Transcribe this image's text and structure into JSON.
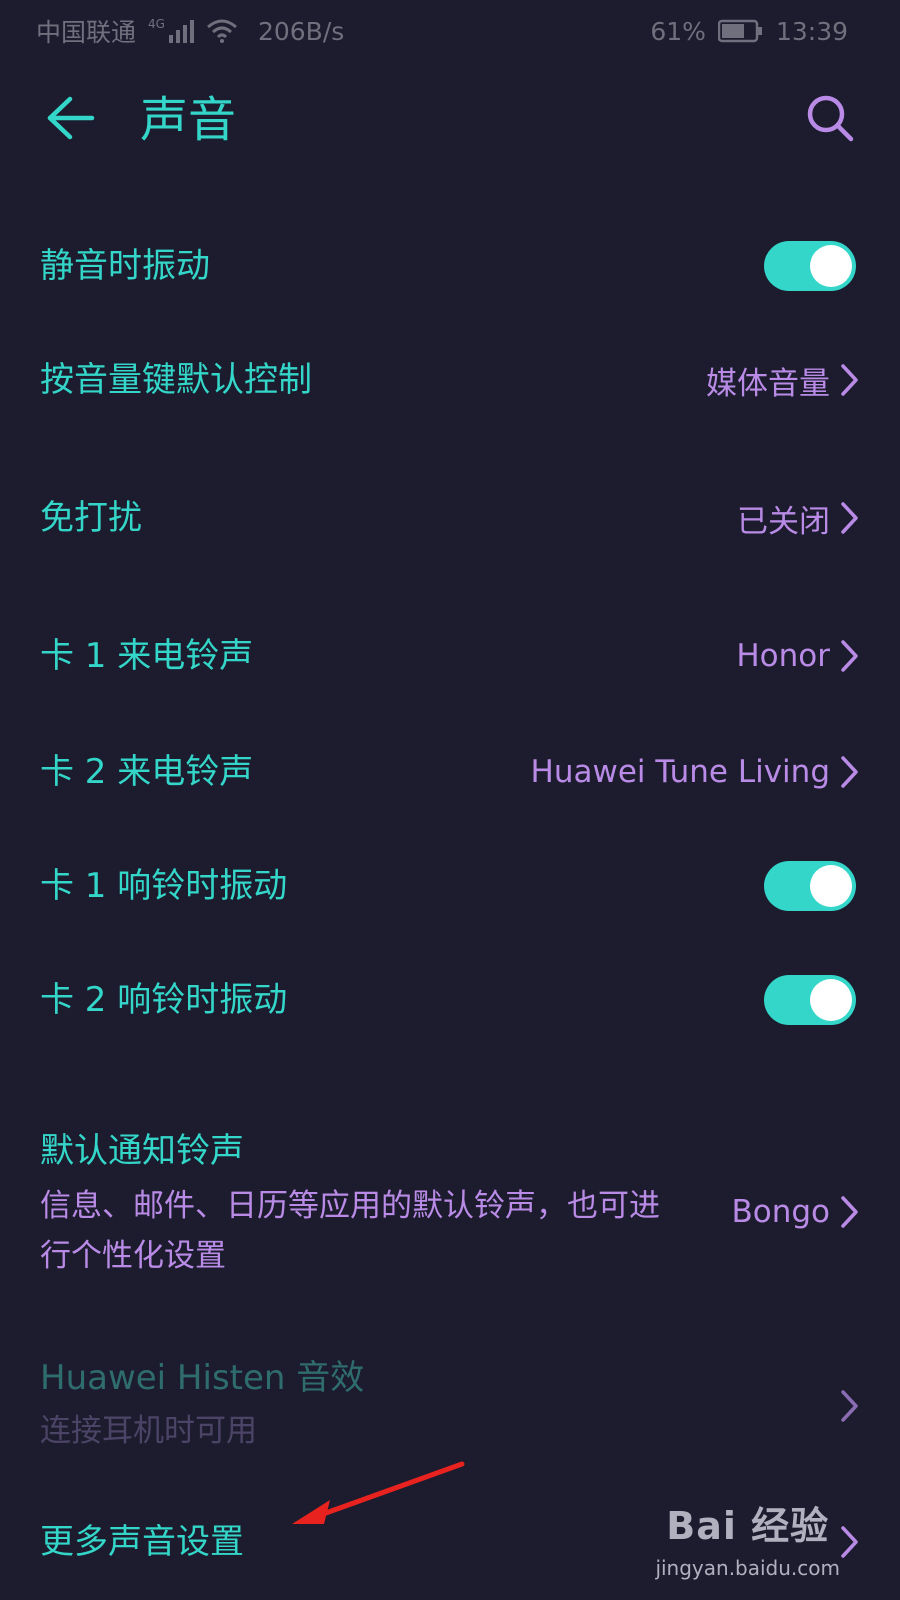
{
  "status_bar": {
    "carrier": "中国联通",
    "network_type": "4G",
    "net_speed": "206B/s",
    "battery": "61%",
    "time": "13:39"
  },
  "header": {
    "title": "声音",
    "back_icon": "back-arrow-icon",
    "search_icon": "search-icon"
  },
  "settings": {
    "vibrate_silent": {
      "label": "静音时振动",
      "enabled": true
    },
    "volume_key": {
      "label": "按音量键默认控制",
      "value": "媒体音量"
    },
    "dnd": {
      "label": "免打扰",
      "value": "已关闭"
    },
    "sim1_ringtone": {
      "label": "卡 1 来电铃声",
      "value": "Honor"
    },
    "sim2_ringtone": {
      "label": "卡 2 来电铃声",
      "value": "Huawei Tune Living"
    },
    "sim1_vibrate": {
      "label": "卡 1 响铃时振动",
      "enabled": true
    },
    "sim2_vibrate": {
      "label": "卡 2 响铃时振动",
      "enabled": true
    },
    "notification_ringtone": {
      "label": "默认通知铃声",
      "subtitle": "信息、邮件、日历等应用的默认铃声，也可进行个性化设置",
      "value": "Bongo"
    },
    "histen": {
      "label": "Huawei Histen 音效",
      "subtitle": "连接耳机时可用"
    },
    "more_sound": {
      "label": "更多声音设置"
    }
  },
  "watermark": {
    "logo": "Bai 经验",
    "url": "jingyan.baidu.com"
  },
  "colors": {
    "background": "#1c1c2e",
    "accent_teal": "#33d6c8",
    "value_purple": "#b98be6",
    "annotation_red": "#e8231f"
  }
}
